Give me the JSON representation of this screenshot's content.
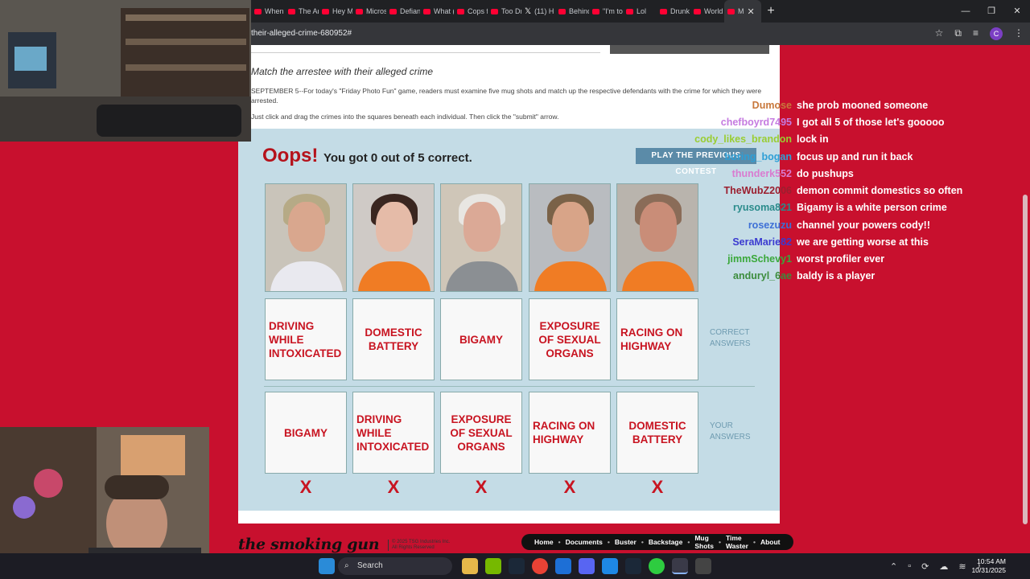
{
  "browser": {
    "tabs": [
      "When",
      "The Ar",
      "Hey M",
      "Micros",
      "Defian",
      "What (",
      "Cops f",
      "Too Dr",
      "(11) H",
      "Behind",
      "\"I'm to",
      "Lol",
      "Drunk",
      "World",
      "M"
    ],
    "url": "their-alleged-crime-680952#",
    "profile_initial": "C"
  },
  "article": {
    "headline": "Match the arrestee with their alleged crime",
    "para1": "SEPTEMBER 5--For today's \"Friday Photo Fun\" game, readers must examine five mug shots and match up the respective defendants with the crime for which they were arrested.",
    "para2": "Just click and drag the crimes into the squares beneath each individual. Then click the \"submit\" arrow."
  },
  "game": {
    "oops": "Oops!",
    "score": "You got 0 out of 5 correct.",
    "play_button": "PLAY THE PREVIOUS CONTEST",
    "correct_label": "CORRECT ANSWERS",
    "your_label": "YOUR ANSWERS",
    "correct_answers": [
      "DRIVING WHILE INTOXICATED",
      "DOMESTIC BATTERY",
      "BIGAMY",
      "EXPOSURE OF SEXUAL ORGANS",
      "RACING ON HIGHWAY"
    ],
    "your_answers": [
      "BIGAMY",
      "DRIVING WHILE INTOXICATED",
      "EXPOSURE OF SEXUAL ORGANS",
      "RACING ON HIGHWAY",
      "DOMESTIC BATTERY"
    ],
    "result_marks": [
      "X",
      "X",
      "X",
      "X",
      "X"
    ]
  },
  "footer": {
    "logo": "the smoking gun",
    "copyright_line1": "© 2025 TSG Industries Inc.",
    "copyright_line2": "All Rights Reserved",
    "nav": [
      "Home",
      "Documents",
      "Buster",
      "Backstage",
      "Mug Shots",
      "Time Waster",
      "About"
    ]
  },
  "chat": [
    {
      "user": "Dumose",
      "text": "she prob mooned someone",
      "color": "#c8783c"
    },
    {
      "user": "chefboyrd7495",
      "text": "I got all 5 of those let's gooooo",
      "color": "#c57be0"
    },
    {
      "user": "cody_likes_brandon",
      "text": "lock in",
      "color": "#9acd32"
    },
    {
      "user": "boring_bogan",
      "text": "focus up and run it back",
      "color": "#2e9fd6"
    },
    {
      "user": "thunderk552",
      "text": "do pushups",
      "color": "#d97bd0"
    },
    {
      "user": "TheWubZ2006",
      "text": "demon commit domestics so often",
      "color": "#9b1f2f"
    },
    {
      "user": "ryusoma821",
      "text": "Bigamy is a white person crime",
      "color": "#2a8b8b"
    },
    {
      "user": "rosezuzu",
      "text": "channel your powers cody!!",
      "color": "#3d6fd6"
    },
    {
      "user": "SeraMarie82",
      "text": "we are getting worse at this",
      "color": "#3a3ad0"
    },
    {
      "user": "jimmSchevy1",
      "text": "worst profiler ever",
      "color": "#3aa83a"
    },
    {
      "user": "anduryl_6ae",
      "text": "baldy is a player",
      "color": "#3c8c3c"
    }
  ],
  "taskbar": {
    "search": "Search",
    "time": "10:54 AM",
    "date": "10/31/2025"
  }
}
